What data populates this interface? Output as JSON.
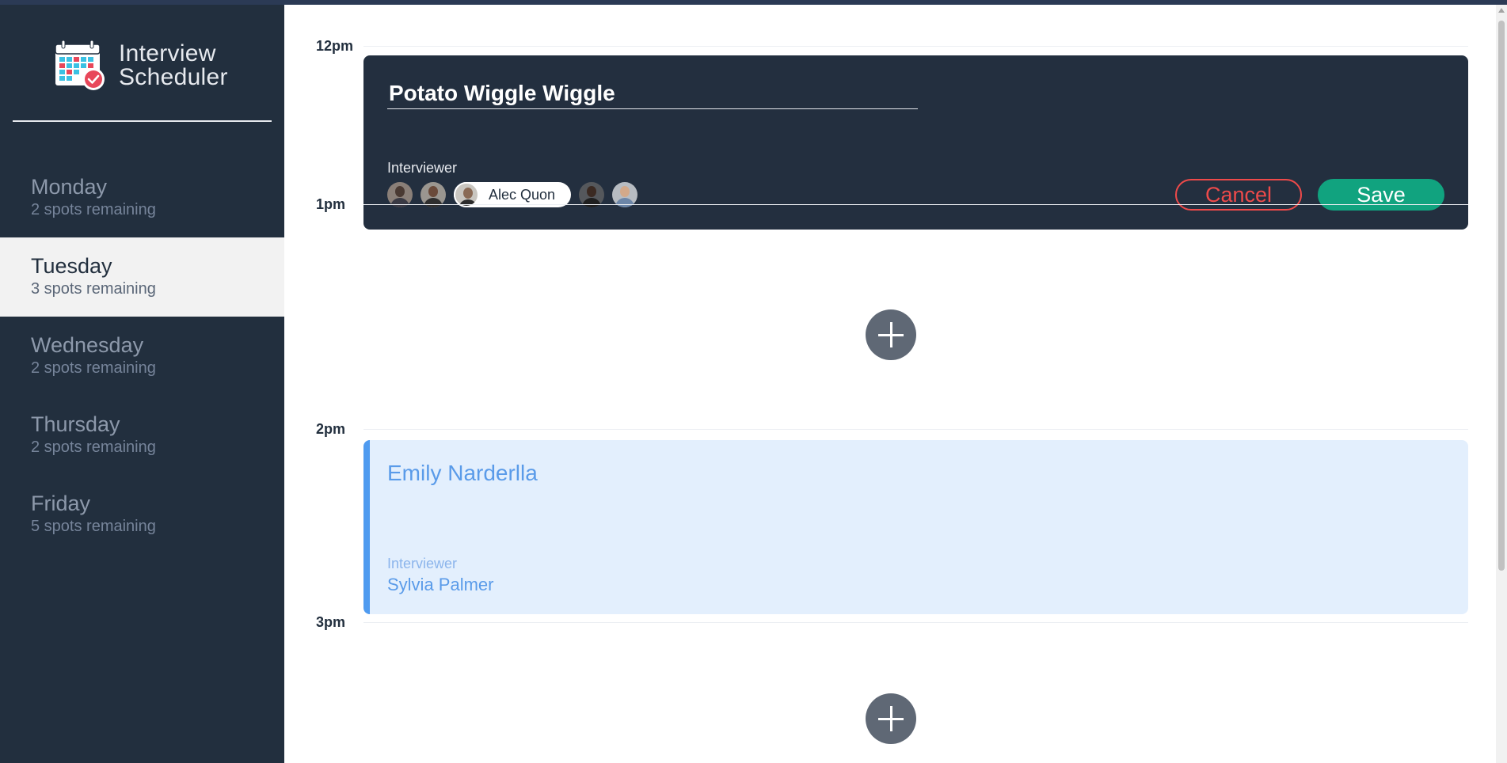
{
  "app": {
    "title_line1": "Interview",
    "title_line2": "Scheduler",
    "logo_icon": "calendar-check-icon",
    "colors": {
      "sidebar": "#222f3e",
      "accent_save": "#11a37f",
      "accent_cancel": "#ee4a4a",
      "appointment": "#e3effd"
    }
  },
  "days": [
    {
      "name": "Monday",
      "spots": "2 spots remaining",
      "selected": false
    },
    {
      "name": "Tuesday",
      "spots": "3 spots remaining",
      "selected": true
    },
    {
      "name": "Wednesday",
      "spots": "2 spots remaining",
      "selected": false
    },
    {
      "name": "Thursday",
      "spots": "2 spots remaining",
      "selected": false
    },
    {
      "name": "Friday",
      "spots": "5 spots remaining",
      "selected": false
    }
  ],
  "hours": [
    "12pm",
    "1pm",
    "2pm",
    "3pm"
  ],
  "form": {
    "student_name": "Potato Wiggle Wiggle",
    "interviewer_heading": "Interviewer",
    "selected_interviewer": "Alec Quon",
    "cancel_label": "Cancel",
    "save_label": "Save"
  },
  "appointment": {
    "student": "Emily Narderlla",
    "interviewer_label": "Interviewer",
    "interviewer": "Sylvia Palmer"
  },
  "add_icon": "plus-icon"
}
